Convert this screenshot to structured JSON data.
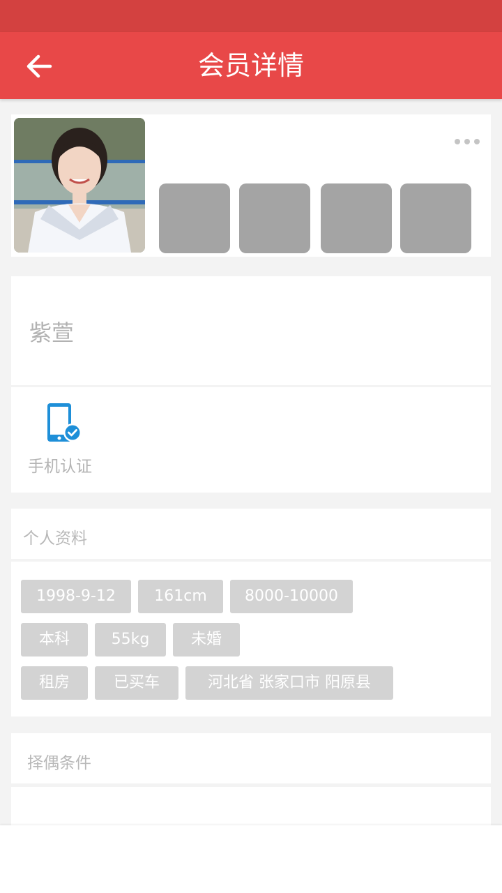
{
  "header": {
    "title": "会员详情",
    "back_icon": "arrow-left-icon"
  },
  "colors": {
    "status_bar": "#d34140",
    "app_bar": "#e84848",
    "tag_bg": "#d3d3d3",
    "verify_icon": "#1e8fd8"
  },
  "profile": {
    "name": "紫萱",
    "more_icon": "more-dots-icon"
  },
  "verification": {
    "label": "手机认证",
    "icon": "phone-verified-icon"
  },
  "personal_info": {
    "title": "个人资料",
    "tags": [
      "1998-9-12",
      "161cm",
      "8000-10000",
      "本科",
      "55kg",
      "未婚",
      "租房",
      "已买车",
      "河北省 张家口市 阳原县"
    ]
  },
  "partner_conditions": {
    "title": "择偶条件"
  }
}
